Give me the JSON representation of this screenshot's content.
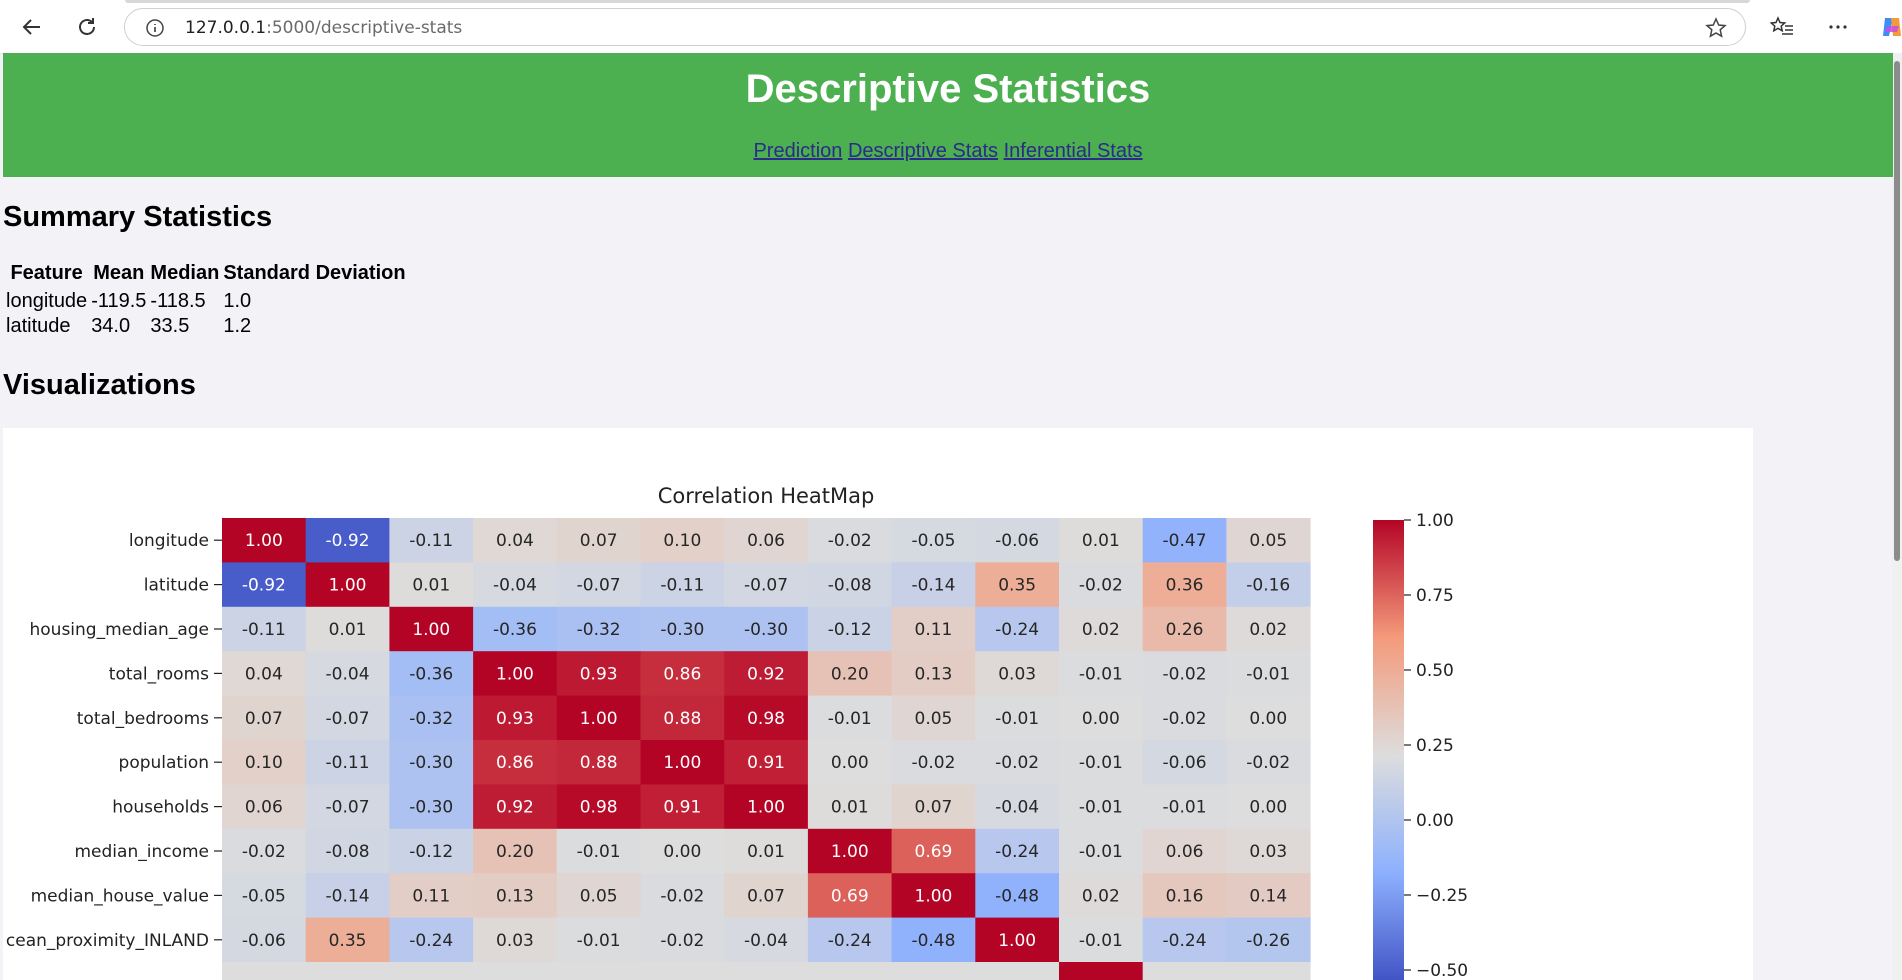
{
  "browser": {
    "url_host": "127.0.0.1",
    "url_path": ":5000/descriptive-stats"
  },
  "header": {
    "title": "Descriptive Statistics",
    "links": [
      "Prediction",
      "Descriptive Stats",
      "Inferential Stats"
    ]
  },
  "summary": {
    "title": "Summary Statistics",
    "columns": [
      "Feature",
      "Mean",
      "Median",
      "Standard Deviation"
    ],
    "rows": [
      [
        "longitude",
        "-119.5",
        "-118.5",
        "1.0"
      ],
      [
        "latitude",
        "34.0",
        "33.5",
        "1.2"
      ]
    ]
  },
  "visualizations": {
    "title": "Visualizations"
  },
  "chart_data": {
    "type": "heatmap",
    "title": "Correlation HeatMap",
    "colormap": "coolwarm",
    "rows": [
      "longitude",
      "latitude",
      "housing_median_age",
      "total_rooms",
      "total_bedrooms",
      "population",
      "households",
      "median_income",
      "median_house_value",
      "cean_proximity_INLAND"
    ],
    "values": [
      [
        1.0,
        -0.92,
        -0.11,
        0.04,
        0.07,
        0.1,
        0.06,
        -0.02,
        -0.05,
        -0.06,
        0.01,
        -0.47,
        0.05
      ],
      [
        -0.92,
        1.0,
        0.01,
        -0.04,
        -0.07,
        -0.11,
        -0.07,
        -0.08,
        -0.14,
        0.35,
        -0.02,
        0.36,
        -0.16
      ],
      [
        -0.11,
        0.01,
        1.0,
        -0.36,
        -0.32,
        -0.3,
        -0.3,
        -0.12,
        0.11,
        -0.24,
        0.02,
        0.26,
        0.02
      ],
      [
        0.04,
        -0.04,
        -0.36,
        1.0,
        0.93,
        0.86,
        0.92,
        0.2,
        0.13,
        0.03,
        -0.01,
        -0.02,
        -0.01
      ],
      [
        0.07,
        -0.07,
        -0.32,
        0.93,
        1.0,
        0.88,
        0.98,
        -0.01,
        0.05,
        -0.01,
        -0.0,
        -0.02,
        0.0
      ],
      [
        0.1,
        -0.11,
        -0.3,
        0.86,
        0.88,
        1.0,
        0.91,
        0.0,
        -0.02,
        -0.02,
        -0.01,
        -0.06,
        -0.02
      ],
      [
        0.06,
        -0.07,
        -0.3,
        0.92,
        0.98,
        0.91,
        1.0,
        0.01,
        0.07,
        -0.04,
        -0.01,
        -0.01,
        0.0
      ],
      [
        -0.02,
        -0.08,
        -0.12,
        0.2,
        -0.01,
        0.0,
        0.01,
        1.0,
        0.69,
        -0.24,
        -0.01,
        0.06,
        0.03
      ],
      [
        -0.05,
        -0.14,
        0.11,
        0.13,
        0.05,
        -0.02,
        0.07,
        0.69,
        1.0,
        -0.48,
        0.02,
        0.16,
        0.14
      ],
      [
        -0.06,
        0.35,
        -0.24,
        0.03,
        -0.01,
        -0.02,
        -0.04,
        -0.24,
        -0.48,
        1.0,
        -0.01,
        -0.24,
        -0.26
      ]
    ],
    "colorbar_ticks": [
      "1.00",
      "0.75",
      "0.50",
      "0.25",
      "0.00",
      "−0.25",
      "−0.50"
    ],
    "colorbar_tick_values": [
      1.0,
      0.75,
      0.5,
      0.25,
      0.0,
      -0.25,
      -0.5
    ],
    "vmin": -1.0,
    "vmax": 1.0,
    "partial_row_values": [
      0,
      0,
      0,
      0,
      0,
      0,
      0,
      0,
      0,
      0,
      1.0,
      0,
      0
    ]
  }
}
